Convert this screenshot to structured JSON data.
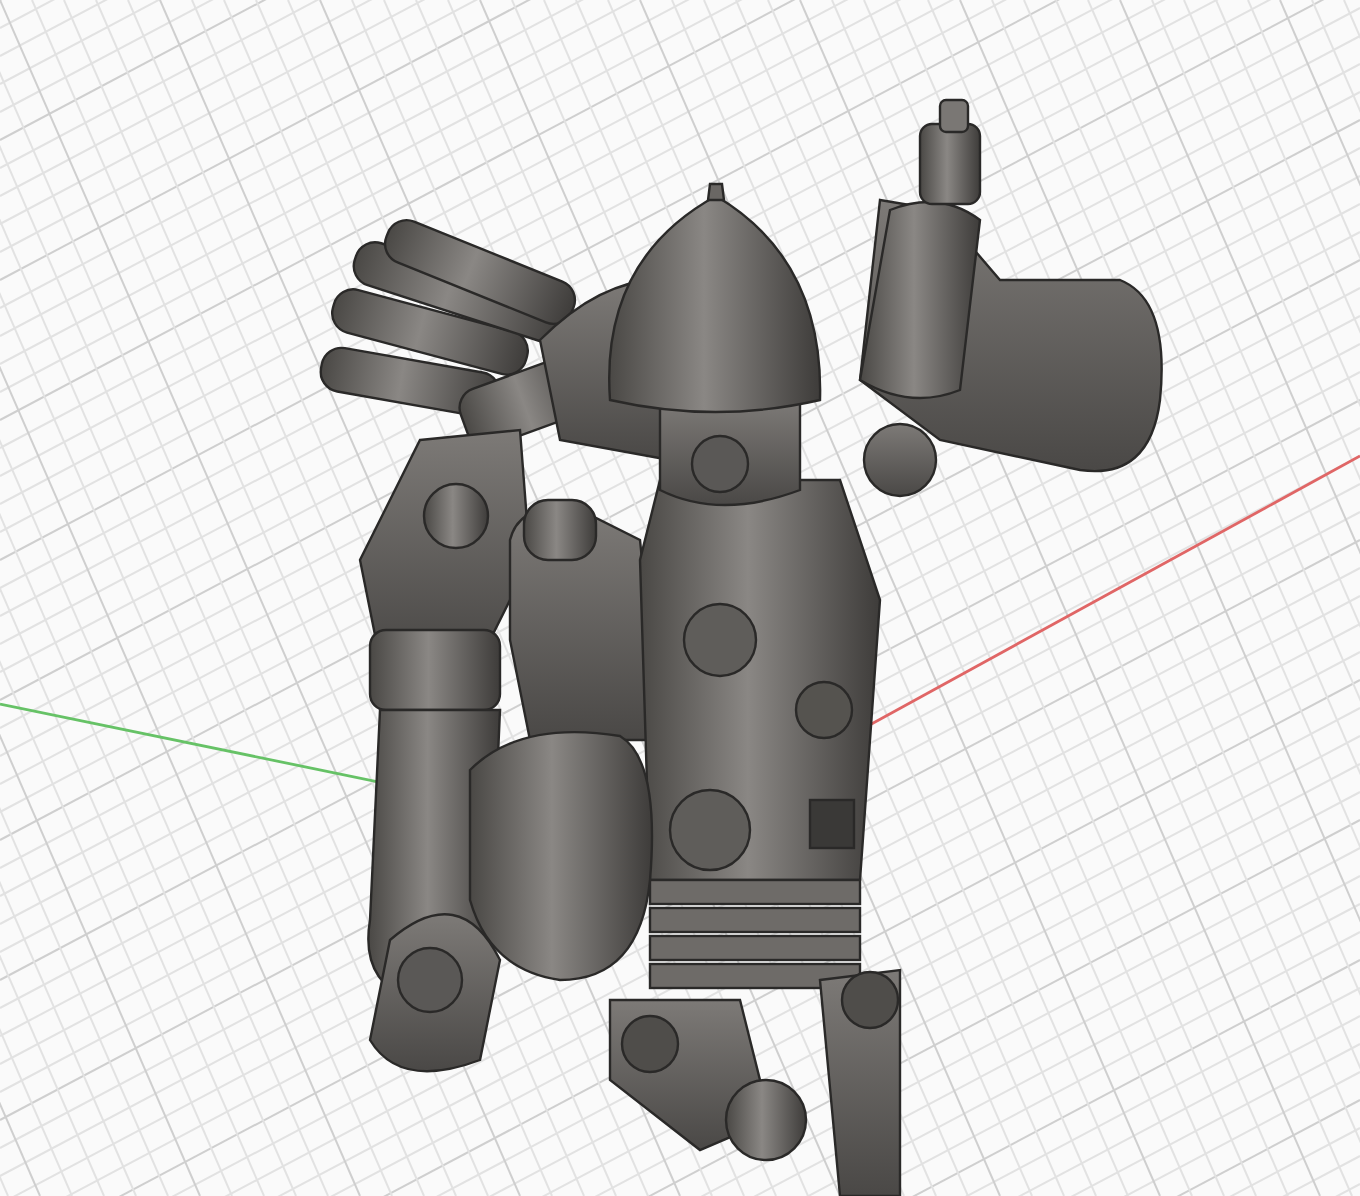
{
  "viewport": {
    "axes": [
      {
        "kind": "x",
        "color": "#e06666"
      },
      {
        "kind": "y",
        "color": "#66c266"
      }
    ]
  }
}
